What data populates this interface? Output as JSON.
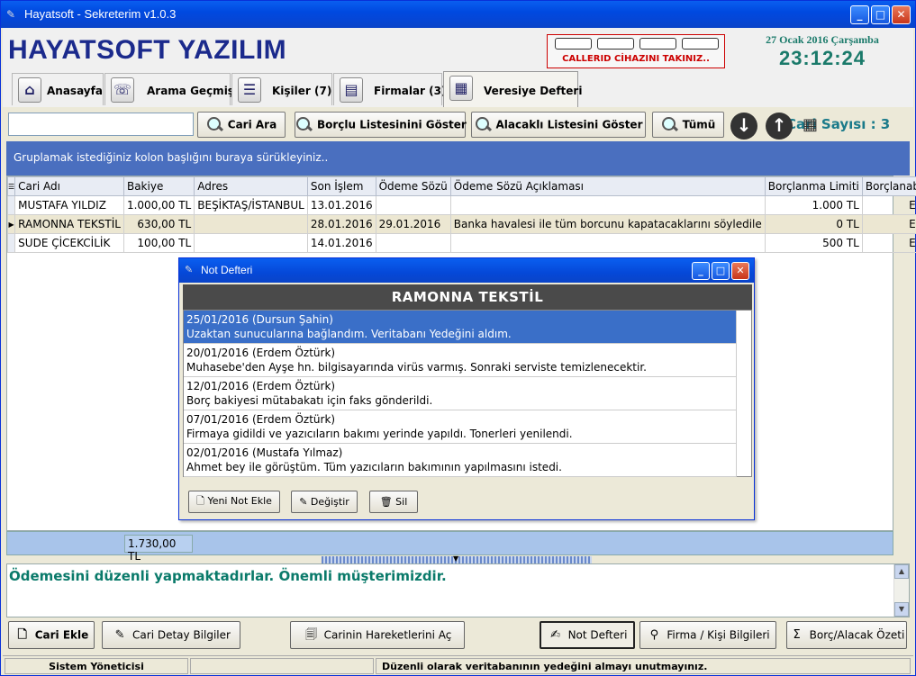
{
  "window": {
    "title": "Hayatsoft - Sekreterim v1.0.3"
  },
  "header": {
    "brand": "HAYATSOFT YAZILIM",
    "callerid_message": "CALLERID CİHAZINI TAKINIZ..",
    "date": "27 Ocak 2016 Çarşamba",
    "time": "23:12:24"
  },
  "tabs": [
    {
      "label": "Anasayfa",
      "icon": "home-icon"
    },
    {
      "label": "Arama Geçmişi",
      "icon": "phone-icon"
    },
    {
      "label": "Kişiler (7)",
      "icon": "contacts-icon"
    },
    {
      "label": "Firmalar (3)",
      "icon": "company-icon"
    },
    {
      "label": "Veresiye Defteri",
      "icon": "ledger-icon",
      "active": true
    }
  ],
  "toolbar": {
    "search_value": "",
    "cari_ara": "Cari Ara",
    "borclu_listesi": "Borçlu Listesinini Göster",
    "alacakli_listesi": "Alacaklı Listesini Göster",
    "tumu": "Tümü",
    "count_label": "Cari Sayısı : 3"
  },
  "grid": {
    "group_hint": "Gruplamak istediğiniz kolon başlığını buraya sürükleyiniz..",
    "columns": [
      "Cari Adı",
      "Bakiye",
      "Adres",
      "Son İşlem",
      "Ödeme Sözü",
      "Ödeme Sözü Açıklaması",
      "Borçlanma Limiti",
      "Borçlanabilir"
    ],
    "rows": [
      [
        "MUSTAFA YILDIZ",
        "1.000,00 TL",
        "BEŞİKTAŞ/İSTANBUL",
        "13.01.2016",
        "",
        "",
        "1.000 TL",
        "Evet"
      ],
      [
        "RAMONNA TEKSTİL",
        "630,00 TL",
        "",
        "28.01.2016",
        "29.01.2016",
        "Banka havalesi ile tüm borcunu kapatacaklarını söyledile",
        "0 TL",
        "Evet"
      ],
      [
        "SUDE ÇİCEKCİLİK",
        "100,00 TL",
        "",
        "14.01.2016",
        "",
        "",
        "500 TL",
        "Evet"
      ]
    ],
    "selected_row": 1,
    "total": "1.730,00 TL"
  },
  "note_panel": {
    "text": "Ödemesini düzenli yapmaktadırlar. Önemli müşterimizdir."
  },
  "bottom_buttons": {
    "cari_ekle": "Cari Ekle",
    "cari_detay": "Cari Detay Bilgiler",
    "hareketler": "Carinin Hareketlerini Aç",
    "not_defteri": "Not Defteri",
    "firma_kisi": "Firma / Kişi Bilgileri",
    "borc_alacak": "Borç/Alacak Özeti"
  },
  "status": {
    "user": "Sistem Yöneticisi",
    "middle": "",
    "message": "Düzenli olarak veritabanının yedeğini almayı unutmayınız."
  },
  "dialog": {
    "title": "Not Defteri",
    "header": "RAMONNA TEKSTİL",
    "notes": [
      {
        "head": "25/01/2016 (Dursun Şahin)",
        "body": "Uzaktan sunucularına bağlandım. Veritabanı Yedeğini aldım."
      },
      {
        "head": "20/01/2016 (Erdem Öztürk)",
        "body": "Muhasebe'den Ayşe hn. bilgisayarında virüs varmış.  Sonraki serviste temizlenecektir."
      },
      {
        "head": "12/01/2016 (Erdem Öztürk)",
        "body": "Borç bakiyesi mütabakatı için faks gönderildi."
      },
      {
        "head": "07/01/2016 (Erdem Öztürk)",
        "body": "Firmaya gidildi ve yazıcıların bakımı yerinde yapıldı. Tonerleri yenilendi."
      },
      {
        "head": "02/01/2016 (Mustafa Yılmaz)",
        "body": "Ahmet bey ile görüştüm. Tüm yazıcıların bakımının yapılmasını istedi."
      }
    ],
    "selected_note": 0,
    "buttons": {
      "add": "Yeni Not Ekle",
      "edit": "Değiştir",
      "delete": "Sil"
    }
  },
  "colors": {
    "accent": "#1b2a8c",
    "teal": "#1a7a6a",
    "alert": "#cc0000",
    "selection": "#3a6fc8"
  }
}
